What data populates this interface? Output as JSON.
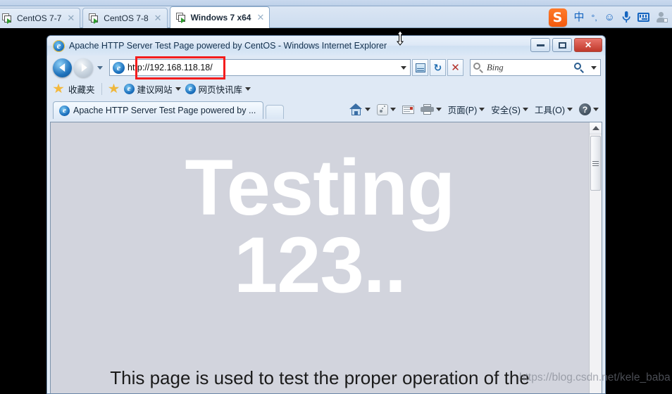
{
  "vmware": {
    "tabs": [
      {
        "label": "CentOS 7-7",
        "icon": "vm-icon",
        "close": "✕",
        "active": false
      },
      {
        "label": "CentOS 7-8",
        "icon": "vm-icon",
        "close": "✕",
        "active": false
      },
      {
        "label": "Windows 7 x64",
        "icon": "vm-icon",
        "close": "✕",
        "active": true
      }
    ]
  },
  "ime": {
    "logo": "S",
    "items": [
      {
        "name": "chinese-mode",
        "glyph": "中"
      },
      {
        "name": "punctuation-mode",
        "glyph": "°,"
      },
      {
        "name": "emoji",
        "glyph": "☺"
      },
      {
        "name": "voice-input",
        "glyph": "ƨ"
      }
    ]
  },
  "ie": {
    "title": "Apache HTTP Server Test Page powered by CentOS - Windows Internet Explorer",
    "window_buttons": {
      "minimize": "minimize-button",
      "maximize": "maximize-button",
      "close": "✕"
    },
    "nav": {
      "back": "back-button",
      "forward": "forward-button",
      "history_dropdown": "recent-pages-dropdown",
      "url": "http://192.168.118.18/",
      "url_dropdown": "address-dropdown",
      "compat_view": "compatibility-view-button",
      "refresh": "↻",
      "stop": "✕"
    },
    "search": {
      "placeholder": "Bing",
      "go": "search-button",
      "dropdown": "search-provider-dropdown"
    },
    "favorites_bar": {
      "favorites_label": "收藏夹",
      "add_to_favorites": "add-to-favorites-bar-button",
      "items": [
        {
          "label": "建议网站"
        },
        {
          "label": "网页快讯库"
        }
      ]
    },
    "tab": {
      "label": "Apache HTTP Server Test Page powered by ...",
      "new_tab": "new-tab-button"
    },
    "commandbar": {
      "home": "home-button",
      "feeds": "feeds-button",
      "mail": "read-mail-button",
      "print": "print-button",
      "page": "页面(P)",
      "safety": "安全(S)",
      "tools": "工具(O)",
      "help": "?"
    }
  },
  "page": {
    "hero_line1": "Testing",
    "hero_line2": "123..",
    "subtitle": "This page is used to test the proper operation of the"
  },
  "overlay": {
    "annotation": "url-highlight-box",
    "watermark": "https://blog.csdn.net/kele_baba"
  },
  "colors": {
    "annotation_red": "#f41d1d",
    "page_bg": "#d2d4dd",
    "hero_text": "#ffffff",
    "ime_orange": "#f2590d"
  }
}
